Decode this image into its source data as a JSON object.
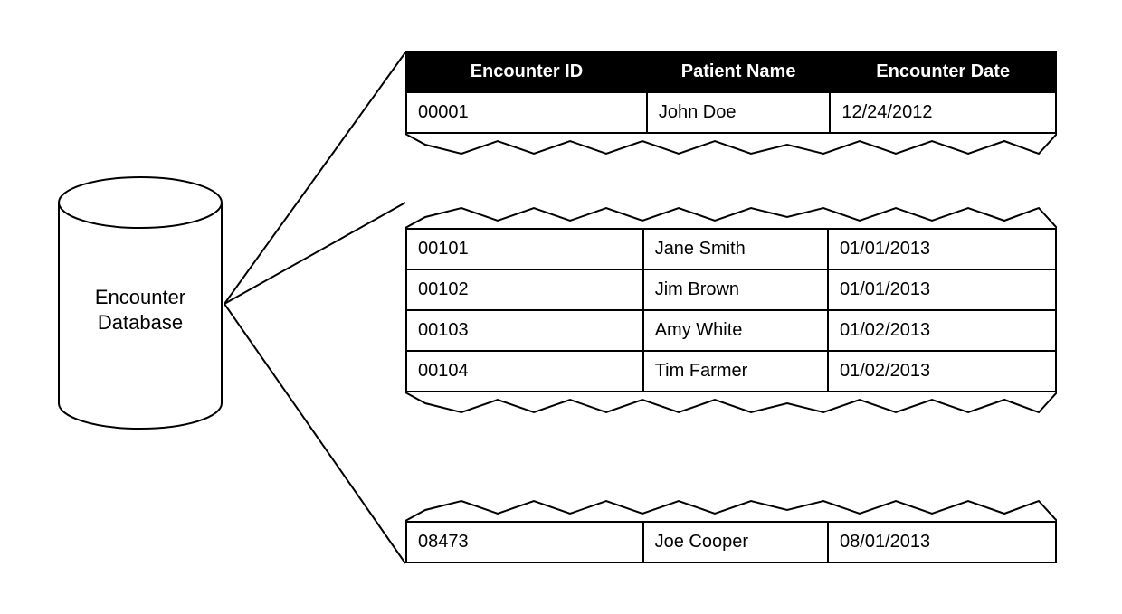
{
  "database": {
    "label": "Encounter\nDatabase"
  },
  "table": {
    "headers": {
      "id": "Encounter ID",
      "name": "Patient Name",
      "date": "Encounter Date"
    },
    "segment_top": [
      {
        "id": "00001",
        "name": "John Doe",
        "date": "12/24/2012"
      }
    ],
    "segment_middle": [
      {
        "id": "00101",
        "name": "Jane Smith",
        "date": "01/01/2013"
      },
      {
        "id": "00102",
        "name": "Jim Brown",
        "date": "01/01/2013"
      },
      {
        "id": "00103",
        "name": "Amy White",
        "date": "01/02/2013"
      },
      {
        "id": "00104",
        "name": "Tim Farmer",
        "date": "01/02/2013"
      }
    ],
    "segment_bottom": [
      {
        "id": "08473",
        "name": "Joe Cooper",
        "date": "08/01/2013"
      }
    ]
  }
}
